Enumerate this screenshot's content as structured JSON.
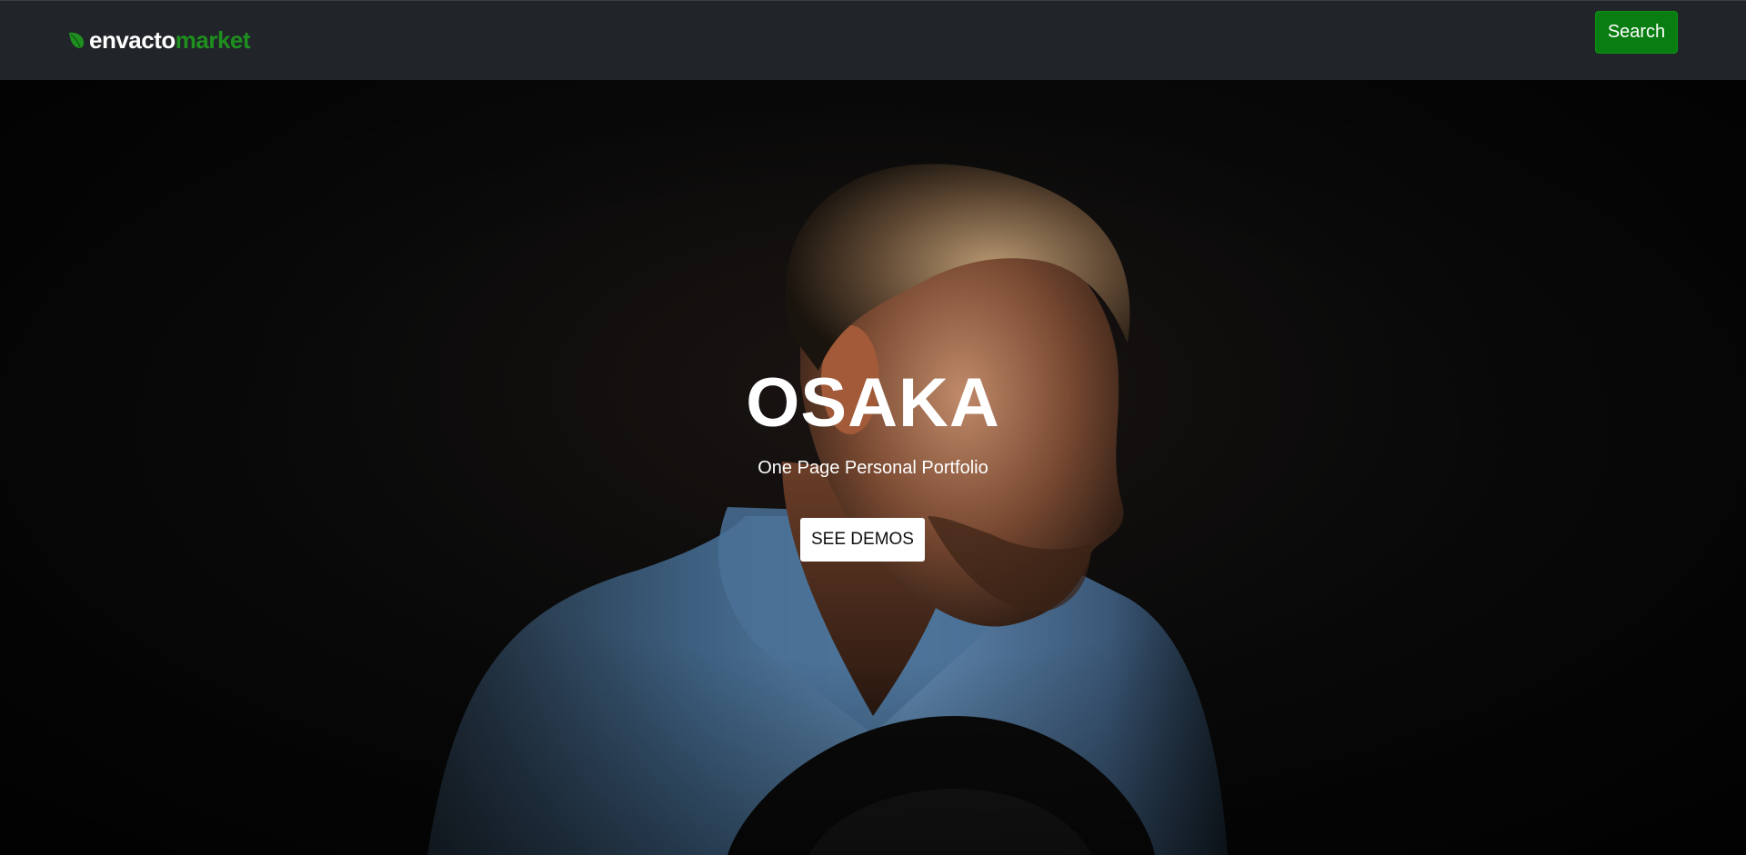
{
  "navbar": {
    "brand": {
      "part1": "envacto",
      "part2": "market",
      "icon": "leaf-icon",
      "accent_color": "#1f8f1f"
    },
    "search_label": "Search",
    "search_color": "#0a7d12",
    "background_color": "#212529"
  },
  "hero": {
    "title": "OSAKA",
    "subtitle": "One Page Personal Portfolio",
    "cta_label": "SEE DEMOS",
    "image": "portrait-photo"
  }
}
